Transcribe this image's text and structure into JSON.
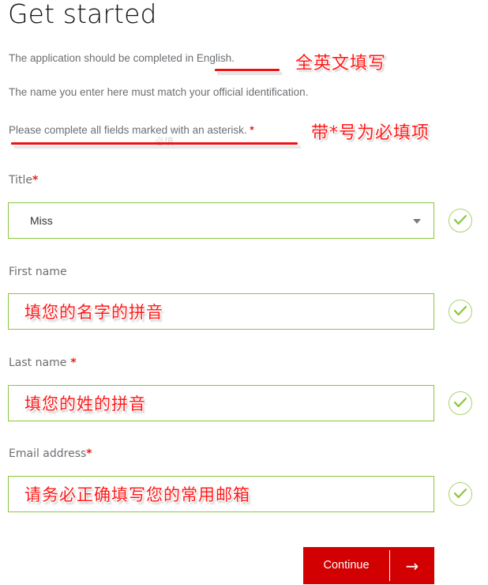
{
  "header": {
    "title": "Get started"
  },
  "intro": {
    "line1_pre": "The application should be completed ",
    "line1_underlined": "in English.",
    "line2": "The name you enter here must match your official identification.",
    "line3": "Please complete all fields marked with an asterisk.",
    "line3_asterisk": "*",
    "ghost_mark": "必填"
  },
  "annotations": {
    "english_note": "全英文填写",
    "asterisk_note": "带*号为必填项"
  },
  "form": {
    "fields": [
      {
        "id": "title",
        "label": "Title",
        "required": true,
        "required_mark": "*",
        "type": "select",
        "value": "Miss",
        "annotation": "",
        "valid": true
      },
      {
        "id": "first-name",
        "label": "First name",
        "required": false,
        "required_mark": "",
        "type": "text",
        "value": "",
        "annotation": "填您的名字的拼音",
        "valid": true
      },
      {
        "id": "last-name",
        "label": "Last name",
        "required": true,
        "required_mark": "*",
        "type": "text",
        "value": "",
        "annotation": "填您的姓的拼音",
        "valid": true
      },
      {
        "id": "email-address",
        "label": "Email address",
        "required": true,
        "required_mark": "*",
        "type": "text",
        "value": "",
        "annotation": "请务必正确填写您的常用邮箱",
        "valid": true
      }
    ],
    "submit": {
      "label": "Continue",
      "arrow": "→"
    }
  },
  "icons": {
    "check": "check-icon",
    "caret": "chevron-down-icon",
    "arrow_right": "arrow-right-icon"
  },
  "colors": {
    "accent_red": "#d20000",
    "annotation_red": "#ff1a1a",
    "field_border_green": "#8cc63e",
    "check_green": "#a9d36a",
    "label_gray": "#6b6e72",
    "asterisk_red": "#e2231a"
  }
}
